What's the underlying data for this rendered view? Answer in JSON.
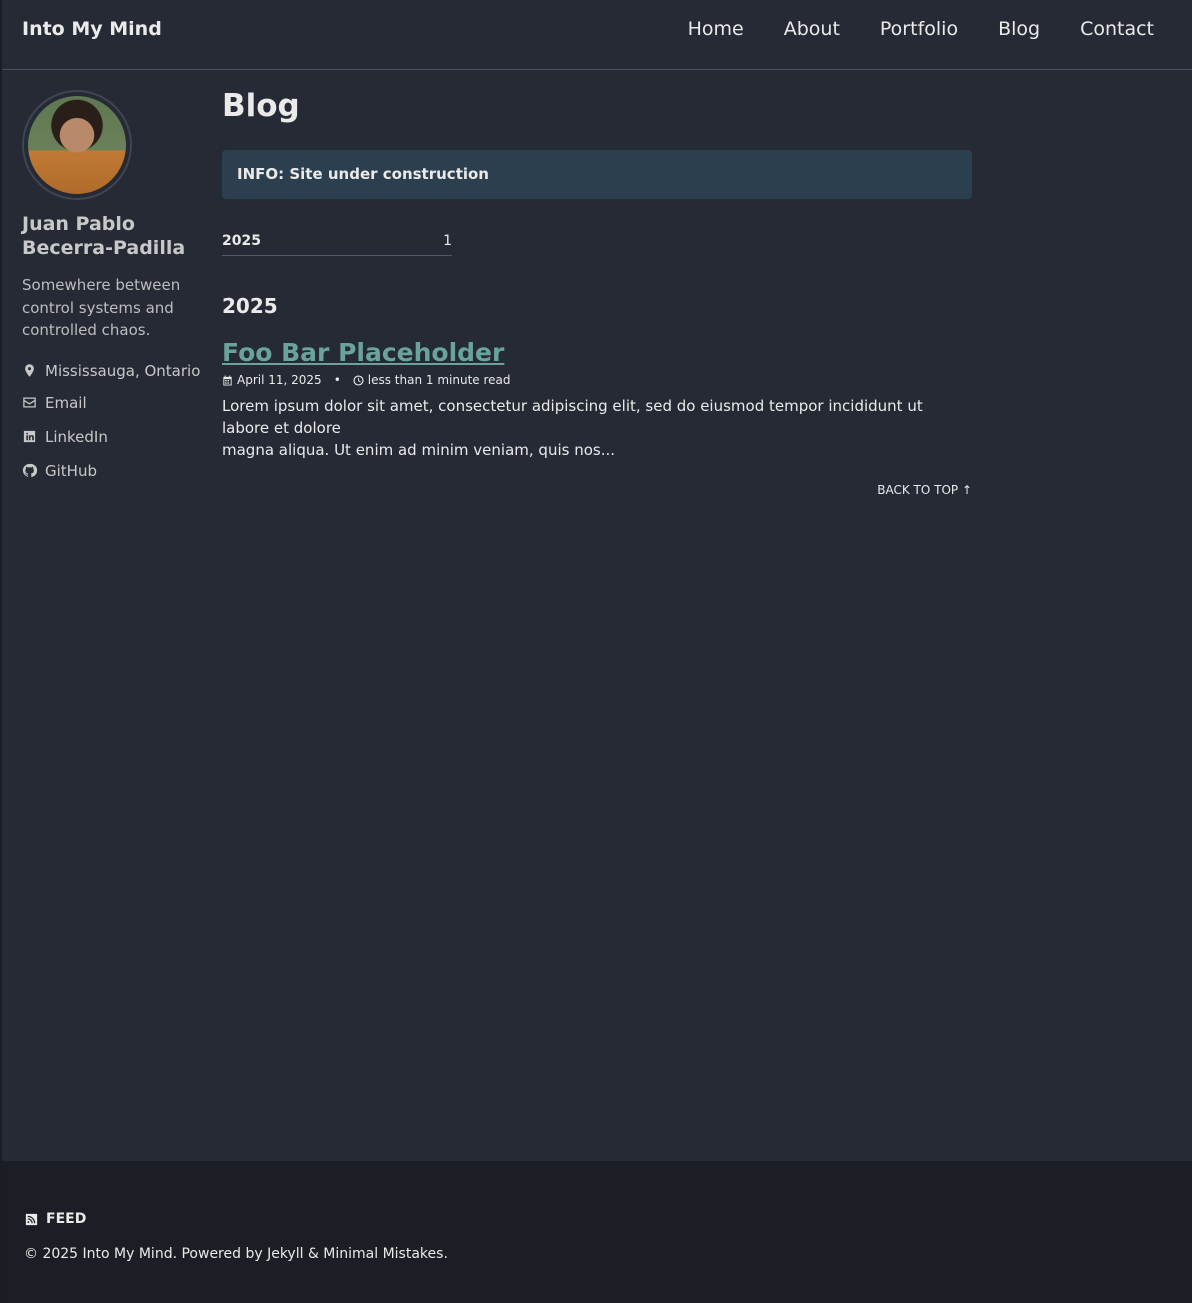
{
  "site": {
    "title": "Into My Mind"
  },
  "nav": {
    "items": [
      {
        "label": "Home"
      },
      {
        "label": "About"
      },
      {
        "label": "Portfolio"
      },
      {
        "label": "Blog"
      },
      {
        "label": "Contact"
      }
    ]
  },
  "sidebar": {
    "avatar_icon": "avatar-photo",
    "name_line1": "Juan Pablo",
    "name_line2": "Becerra-Padilla",
    "bio_line1": "Somewhere between",
    "bio_line2": "control systems and",
    "bio_line3": "controlled chaos.",
    "links": [
      {
        "icon": "location-icon",
        "label": "Mississauga, Ontario"
      },
      {
        "icon": "envelope-icon",
        "label": "Email"
      },
      {
        "icon": "linkedin-icon",
        "label": "LinkedIn"
      },
      {
        "icon": "github-icon",
        "label": "GitHub"
      }
    ]
  },
  "main": {
    "page_title": "Blog",
    "notice": "INFO: Site under construction",
    "taxonomy": {
      "year": "2025",
      "count": "1"
    },
    "archive_year": "2025",
    "post": {
      "title": "Foo Bar Placeholder",
      "date": "April 11, 2025",
      "separator": "•",
      "read_time": "less than 1 minute read",
      "excerpt_line1": "Lorem ipsum dolor sit amet, consectetur adipiscing elit, sed do eiusmod tempor incididunt ut labore et dolore",
      "excerpt_line2": "magna aliqua. Ut enim ad minim veniam, quis nos..."
    },
    "back_to_top": "BACK TO TOP ↑"
  },
  "footer": {
    "feed_label": "FEED",
    "copyright": "© 2025 Into My Mind. Powered by Jekyll & Minimal Mistakes."
  },
  "colors": {
    "background": "#252a34",
    "footer_bg": "#1b1e24",
    "link_accent": "#6aa39b",
    "notice_bg": "#2c3f4f"
  }
}
